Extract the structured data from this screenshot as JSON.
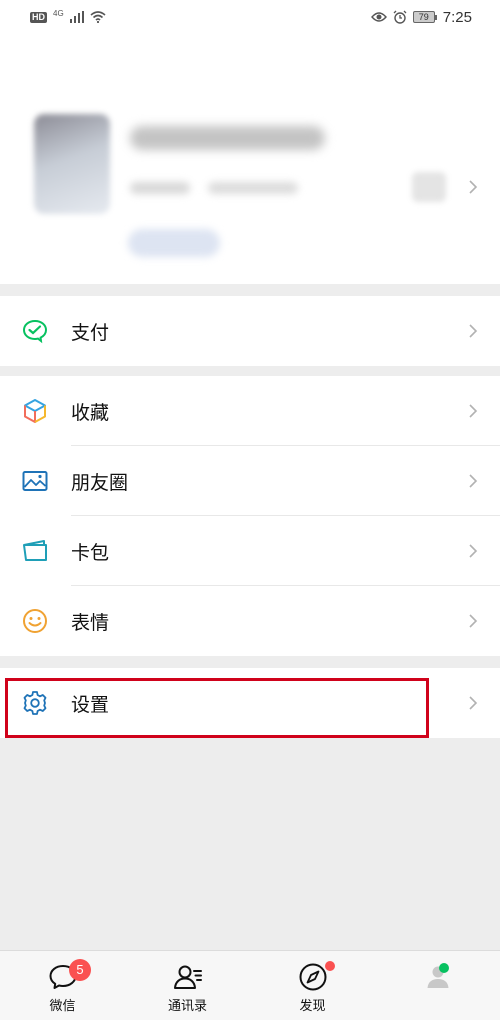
{
  "statusbar": {
    "hd": "HD",
    "network": "4G",
    "battery": "79",
    "time": "7:25"
  },
  "menu": {
    "pay": "支付",
    "favorites": "收藏",
    "moments": "朋友圈",
    "cards": "卡包",
    "stickers": "表情",
    "settings": "设置"
  },
  "tabs": {
    "chats": "微信",
    "chats_badge": "5",
    "contacts": "通讯录",
    "discover": "发现"
  },
  "colors": {
    "brand_green": "#07c160",
    "badge_red": "#fa5151",
    "highlight": "#d0021b",
    "settings_blue": "#1f73b7"
  }
}
